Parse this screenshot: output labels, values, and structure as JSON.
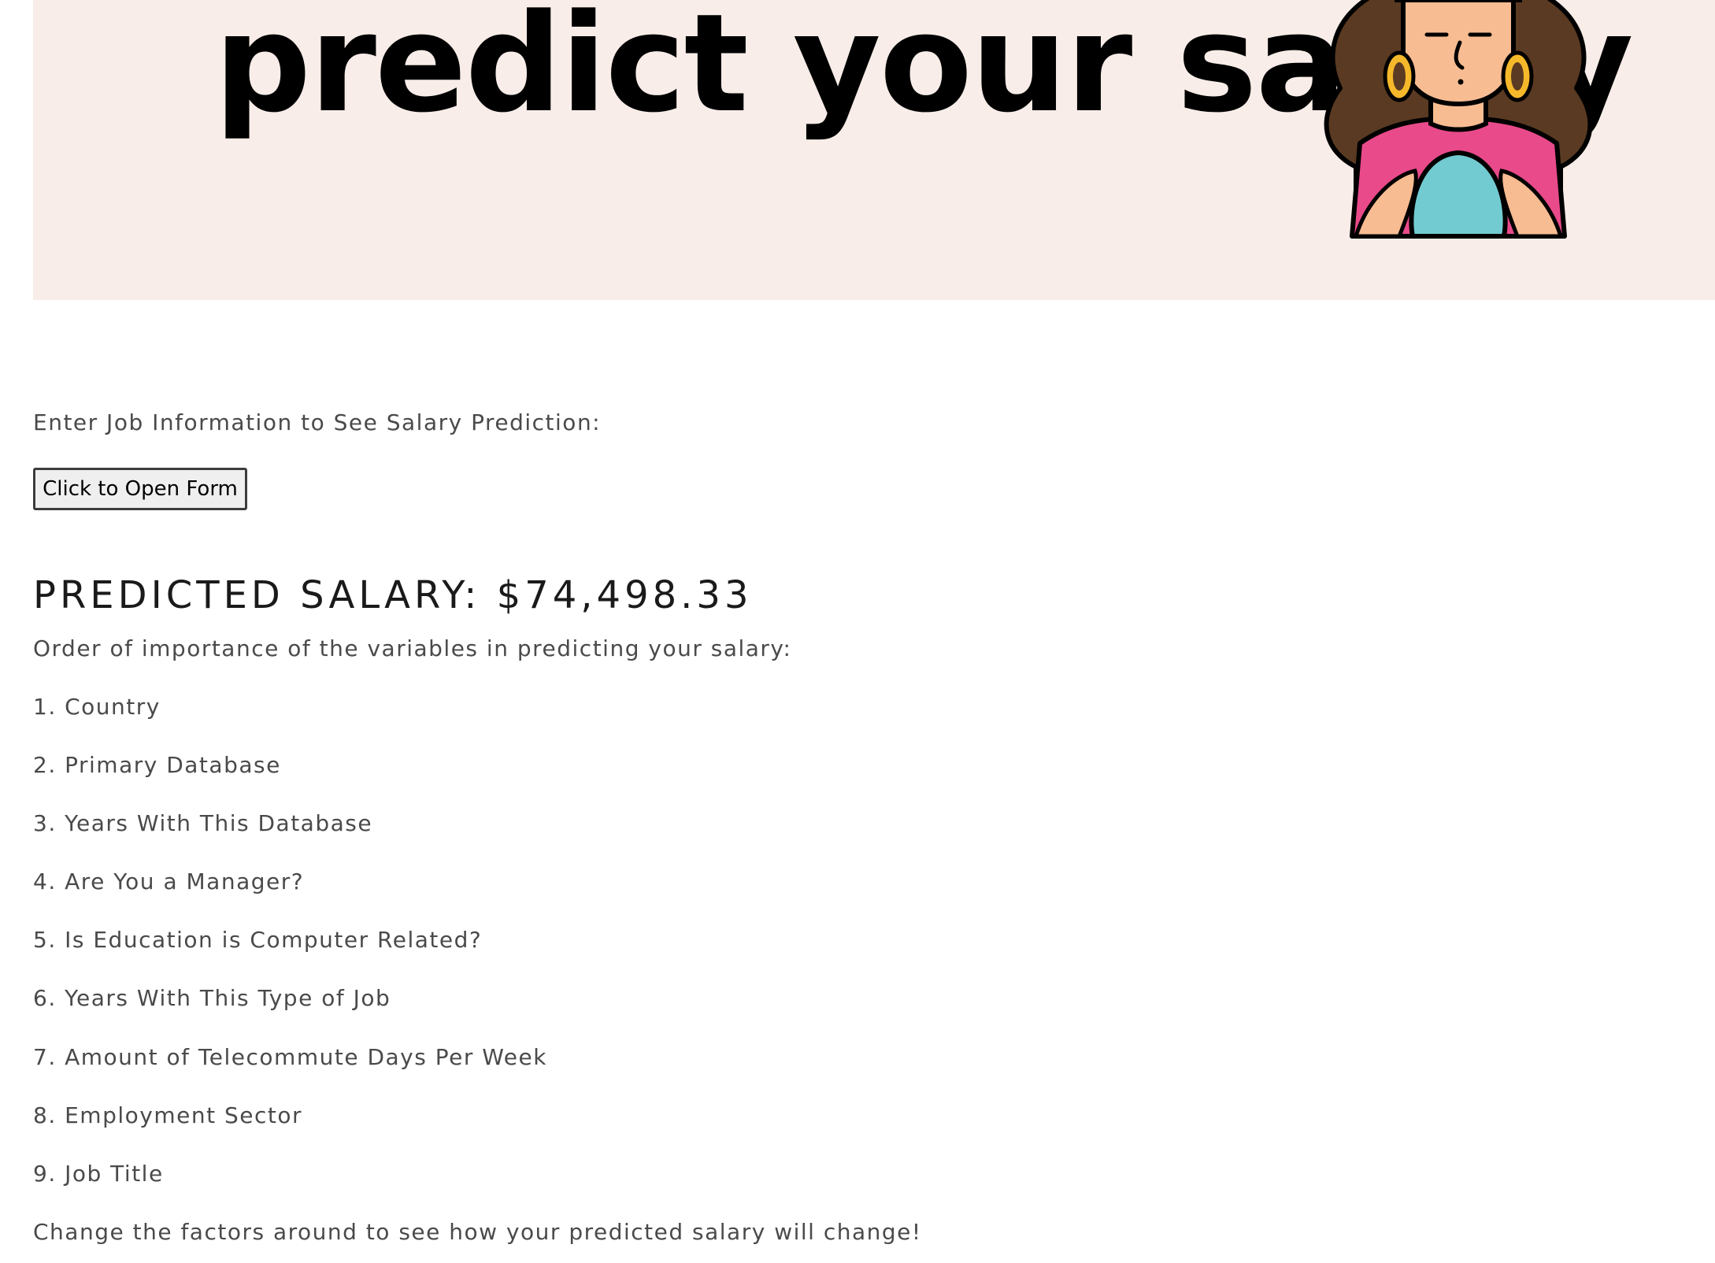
{
  "banner": {
    "title": "predict your salary",
    "illustration": "fortune-teller-with-crystal-ball",
    "background_color": "#f8ede8"
  },
  "intro_text": "Enter Job Information to See Salary Prediction:",
  "open_form_button": "Click to Open Form",
  "prediction": {
    "label": "Predicted Salary:",
    "value": "$74,498.33"
  },
  "importance_intro": "Order of importance of the variables in predicting your salary:",
  "factors": [
    "1. Country",
    "2. Primary Database",
    "3. Years With This Database",
    "4. Are You a Manager?",
    "5. Is Education is Computer Related?",
    "6. Years With This Type of Job",
    "7. Amount of Telecommute Days Per Week",
    "8. Employment Sector",
    "9. Job Title"
  ],
  "closing_text": "Change the factors around to see how your predicted salary will change!"
}
